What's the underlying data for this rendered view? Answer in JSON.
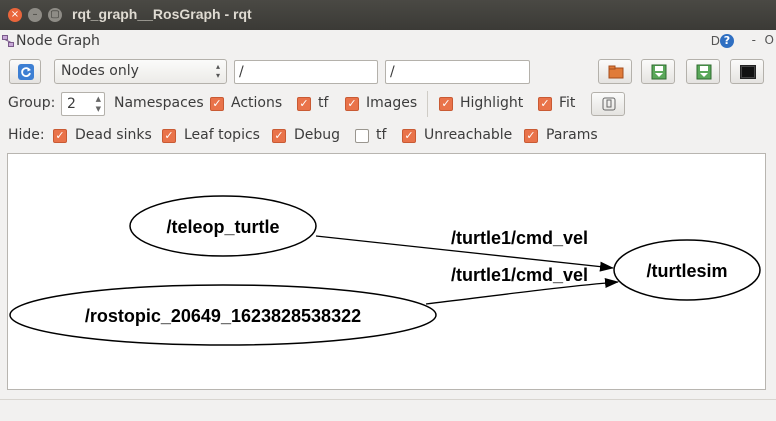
{
  "window": {
    "title": "rqt_graph__RosGraph - rqt",
    "close_glyph": "×",
    "min_glyph": "–",
    "max_glyph": "▢"
  },
  "plugin": {
    "title": "Node Graph",
    "help_d": "D",
    "help_q": "?",
    "minimize": "-",
    "close": "O"
  },
  "toolbar": {
    "refresh_icon": "refresh-icon",
    "graph_mode": "Nodes only",
    "node_filter": "/",
    "topic_filter": "/"
  },
  "options": {
    "group_label": "Group:",
    "group_value": "2",
    "namespaces_label": "Namespaces",
    "actions_label": "Actions",
    "tf_label": "tf",
    "images_label": "Images",
    "highlight_label": "Highlight",
    "fit_label": "Fit",
    "namespaces_checked": true,
    "actions_checked": true,
    "images_checked": true,
    "highlight_checked": true,
    "fit_checked": true
  },
  "hide": {
    "label": "Hide:",
    "dead_sinks": "Dead sinks",
    "leaf_topics": "Leaf topics",
    "debug": "Debug",
    "tf": "tf",
    "unreachable": "Unreachable",
    "params": "Params",
    "tf_checked": false
  },
  "graph": {
    "nodes": {
      "teleop": "/teleop_turtle",
      "turtlesim": "/turtlesim",
      "rostopic": "/rostopic_20649_1623828538322"
    },
    "edges": {
      "top": "/turtle1/cmd_vel",
      "bottom": "/turtle1/cmd_vel"
    }
  },
  "colors": {
    "accent": "#e9734a",
    "titlebar": "#3b3a36"
  }
}
